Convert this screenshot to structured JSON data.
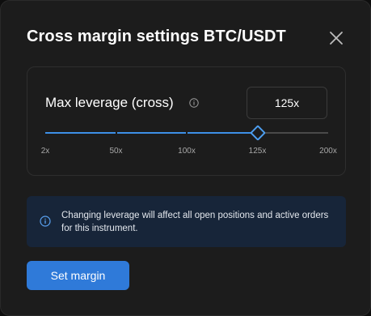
{
  "dialog": {
    "title": "Cross margin settings BTC/USDT"
  },
  "leverage": {
    "label": "Max leverage (cross)",
    "input_value": "125x",
    "slider": {
      "min": 2,
      "max": 200,
      "value": 125,
      "ticks": [
        {
          "label": "2x",
          "value": 2
        },
        {
          "label": "50x",
          "value": 50
        },
        {
          "label": "100x",
          "value": 100
        },
        {
          "label": "125x",
          "value": 125
        },
        {
          "label": "200x",
          "value": 200
        }
      ]
    }
  },
  "banner": {
    "text": "Changing leverage will affect all open positions and active orders for this instrument."
  },
  "actions": {
    "submit_label": "Set margin"
  },
  "colors": {
    "accent": "#2f7ad9",
    "slider_fill": "#3d8fe6",
    "banner_bg": "#172539",
    "surface": "#1c1c1c"
  },
  "icons": {
    "close": "close-icon",
    "leverage_info": "info-icon",
    "banner_info": "info-icon"
  }
}
